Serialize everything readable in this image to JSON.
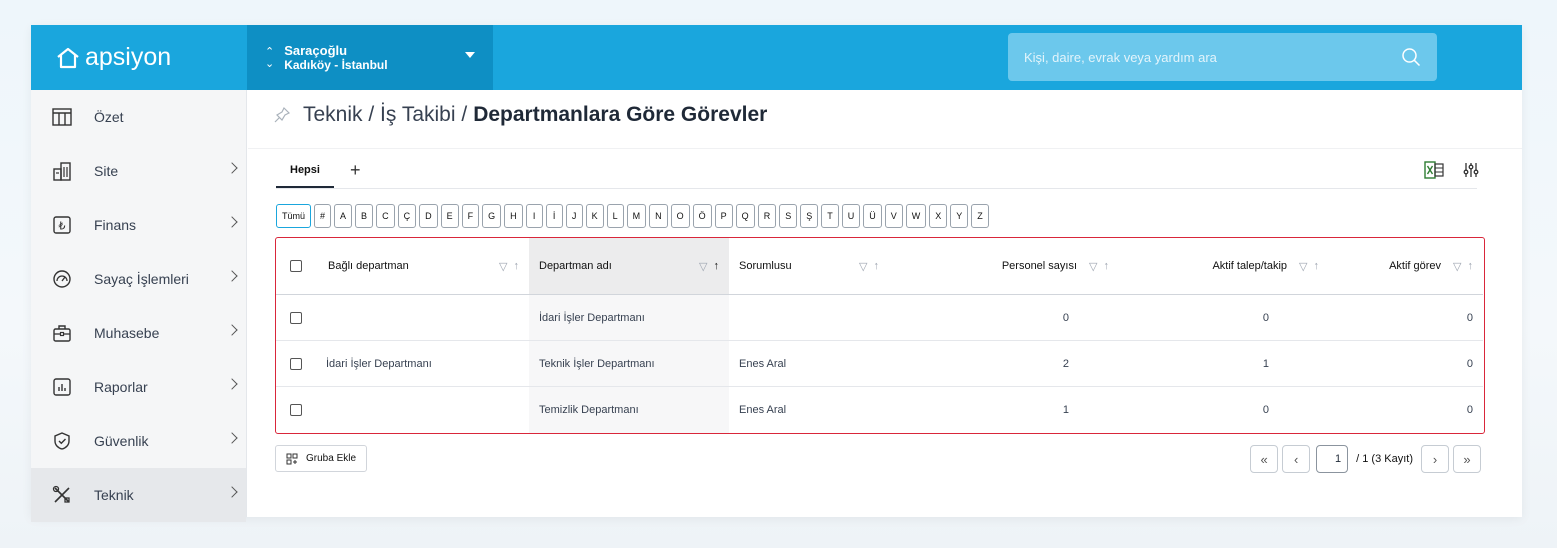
{
  "brand": {
    "name": "apsiyon"
  },
  "site": {
    "name": "Saraçoğlu",
    "location": "Kadıköy - İstanbul"
  },
  "search": {
    "placeholder": "Kişi, daire, evrak veya yardım ara"
  },
  "sidebar": {
    "items": [
      {
        "label": "Özet",
        "icon": "dashboard-icon",
        "chevron": false
      },
      {
        "label": "Site",
        "icon": "building-icon",
        "chevron": true
      },
      {
        "label": "Finans",
        "icon": "lira-icon",
        "chevron": true
      },
      {
        "label": "Sayaç İşlemleri",
        "icon": "meter-icon",
        "chevron": true
      },
      {
        "label": "Muhasebe",
        "icon": "briefcase-icon",
        "chevron": true
      },
      {
        "label": "Raporlar",
        "icon": "report-icon",
        "chevron": true
      },
      {
        "label": "Güvenlik",
        "icon": "shield-icon",
        "chevron": true
      },
      {
        "label": "Teknik",
        "icon": "tools-icon",
        "chevron": true,
        "active": true
      }
    ]
  },
  "breadcrumb": {
    "part1": "Teknik / İş Takibi /",
    "current": "Departmanlara Göre Görevler"
  },
  "tabs": {
    "active": "Hepsi",
    "add": "+"
  },
  "letters": [
    "Tümü",
    "#",
    "A",
    "B",
    "C",
    "Ç",
    "D",
    "E",
    "F",
    "G",
    "H",
    "I",
    "İ",
    "J",
    "K",
    "L",
    "M",
    "N",
    "O",
    "Ö",
    "P",
    "Q",
    "R",
    "S",
    "Ş",
    "T",
    "U",
    "Ü",
    "V",
    "W",
    "X",
    "Y",
    "Z"
  ],
  "table": {
    "headers": [
      "Bağlı departman",
      "Departman adı",
      "Sorumlusu",
      "Personel sayısı",
      "Aktif talep/takip",
      "Aktif görev"
    ],
    "rows": [
      [
        "",
        "İdari İşler Departmanı",
        "",
        "0",
        "0",
        "0"
      ],
      [
        "İdari İşler Departmanı",
        "Teknik İşler Departmanı",
        "Enes Aral",
        "2",
        "1",
        "0"
      ],
      [
        "",
        "Temizlik Departmanı",
        "Enes Aral",
        "1",
        "0",
        "0"
      ]
    ]
  },
  "actions": {
    "group_add": "Gruba Ekle"
  },
  "pager": {
    "current_page": "1",
    "summary": "/ 1 (3 Kayıt)"
  },
  "colors": {
    "topbar": "#1aa6dd",
    "site_switch": "#0e8fc4",
    "highlight_border": "#d9263a"
  }
}
